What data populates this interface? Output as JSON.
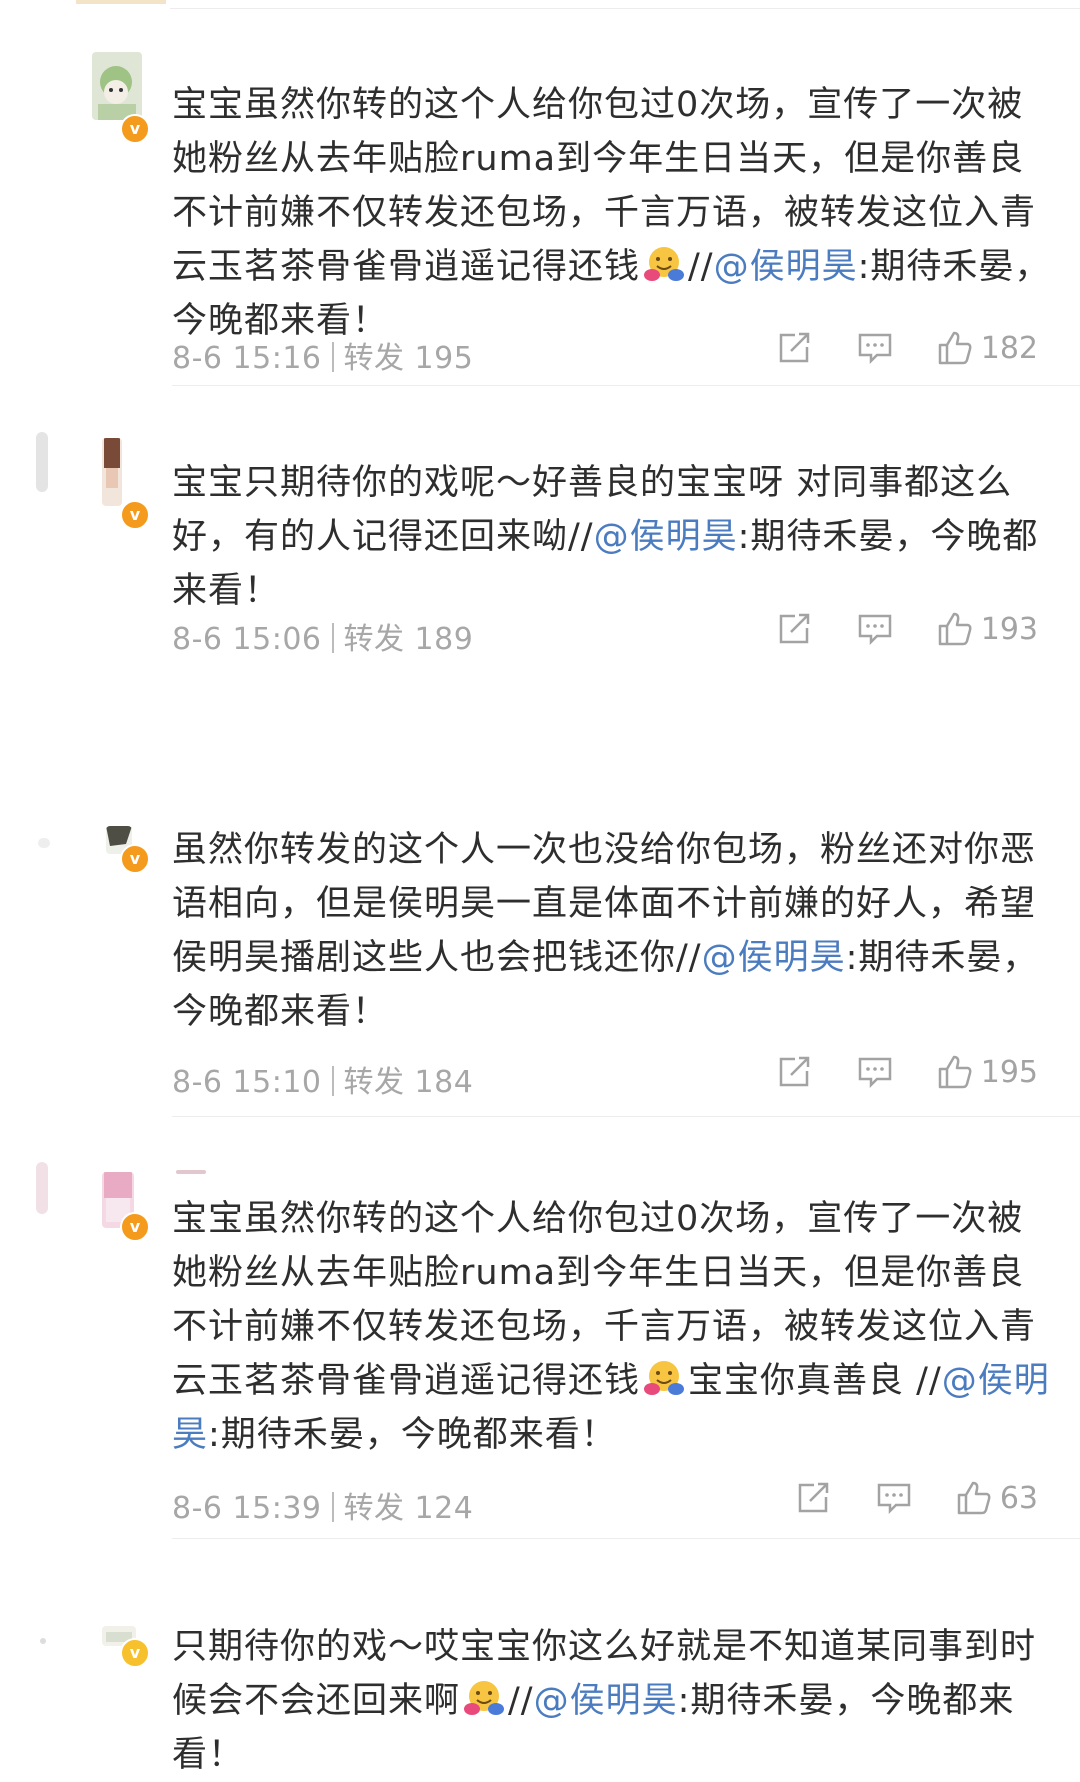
{
  "comments": [
    {
      "text_a": "宝宝虽然你转的这个人给你包过0次场，宣传了一次被她粉丝从去年贴脸ruma到今年生日当天，但是你善良不计前嫌不仅转发还包场，千言万语，被转发这位入青云玉茗茶骨雀骨逍遥记得还钱",
      "text_b": "//",
      "mention": "@侯明昊",
      "text_c": ":期待禾晏，今晚都来看！",
      "time": "8-6 15:16",
      "repost_label": "转发",
      "repost_count": "195",
      "likes": "182",
      "badge_icon": "orange-verified-badge"
    },
    {
      "text_a": "宝宝只期待你的戏呢～好善良的宝宝呀 对同事都这么好，有的人记得还回来呦",
      "text_b": "//",
      "mention": "@侯明昊",
      "text_c": ":期待禾晏，今晚都来看！",
      "time": "8-6 15:06",
      "repost_label": "转发",
      "repost_count": "189",
      "likes": "193",
      "badge_icon": "orange-verified-badge"
    },
    {
      "text_a": "虽然你转发的这个人一次也没给你包场，粉丝还对你恶语相向，但是侯明昊一直是体面不计前嫌的好人，希望侯明昊播剧这些人也会把钱还你",
      "text_b": "//",
      "mention": "@侯明昊",
      "text_c": ":期待禾晏，今晚都来看！",
      "time": "8-6 15:10",
      "repost_label": "转发",
      "repost_count": "184",
      "likes": "195",
      "badge_icon": "orange-verified-badge"
    },
    {
      "text_a": "宝宝虽然你转的这个人给你包过0次场，宣传了一次被她粉丝从去年贴脸ruma到今年生日当天，但是你善良不计前嫌不仅转发还包场，千言万语，被转发这位入青云玉茗茶骨雀骨逍遥记得还钱",
      "text_a2": "宝宝你真善良",
      "text_b": "//",
      "mention": "@侯明昊",
      "text_c": ":期待禾晏，今晚都来看！",
      "time": "8-6 15:39",
      "repost_label": "转发",
      "repost_count": "124",
      "likes": "63",
      "badge_icon": "orange-verified-badge"
    },
    {
      "text_a": "只期待你的戏～哎宝宝你这么好就是不知道某同事到时候会不会还回来啊",
      "text_b": "//",
      "mention": "@侯明昊",
      "text_c": ":期待禾晏，今晚都来看！",
      "badge_icon": "yellow-verified-badge"
    }
  ],
  "icons": {
    "share": "share-icon",
    "comment": "comment-icon",
    "like": "thumbs-up-icon",
    "emoji": "hug-emoji-icon"
  },
  "colors": {
    "mention": "#4b7cbf",
    "meta": "#a7a7a7",
    "badge_orange": "#f49b1d",
    "badge_yellow": "#f6c12c"
  }
}
